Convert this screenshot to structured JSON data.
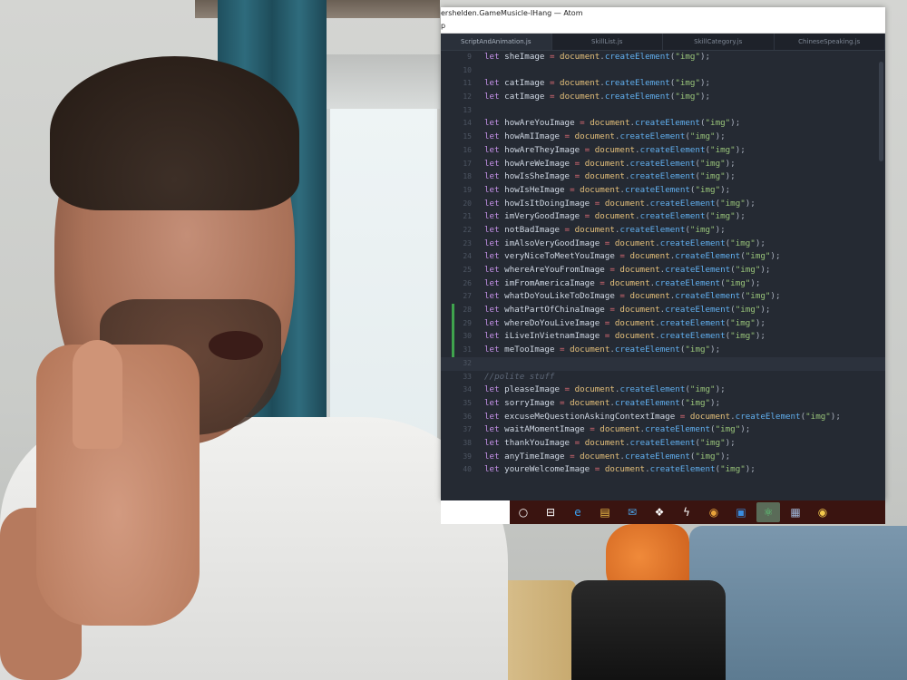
{
  "window": {
    "title": "ershelden.GameMusicle-IHang — Atom",
    "menu_label": "p"
  },
  "tabs": [
    {
      "label": "ScriptAndAnimation.js"
    },
    {
      "label": "SkillList.js"
    },
    {
      "label": "SkillCategory.js"
    },
    {
      "label": "ChineseSpeaking.js"
    }
  ],
  "code_lines": [
    {
      "num": "9",
      "marker": "",
      "kw": "let",
      "name": "sheImage",
      "obj": "document",
      "fn": "createElement",
      "arg": "\"img\""
    },
    {
      "num": "10",
      "marker": "",
      "blank": true
    },
    {
      "num": "11",
      "marker": "",
      "kw": "let",
      "name": "catImage",
      "obj": "document",
      "fn": "createElement",
      "arg": "\"img\""
    },
    {
      "num": "12",
      "marker": "",
      "kw": "let",
      "name": "catImage",
      "obj": "document",
      "fn": "createElement",
      "arg": "\"img\""
    },
    {
      "num": "13",
      "marker": "",
      "blank": true
    },
    {
      "num": "14",
      "marker": "",
      "kw": "let",
      "name": "howAreYouImage",
      "obj": "document",
      "fn": "createElement",
      "arg": "\"img\""
    },
    {
      "num": "15",
      "marker": "",
      "kw": "let",
      "name": "howAmIImage",
      "obj": "document",
      "fn": "createElement",
      "arg": "\"img\""
    },
    {
      "num": "16",
      "marker": "",
      "kw": "let",
      "name": "howAreTheyImage",
      "obj": "document",
      "fn": "createElement",
      "arg": "\"img\""
    },
    {
      "num": "17",
      "marker": "",
      "kw": "let",
      "name": "howAreWeImage",
      "obj": "document",
      "fn": "createElement",
      "arg": "\"img\""
    },
    {
      "num": "18",
      "marker": "",
      "kw": "let",
      "name": "howIsSheImage",
      "obj": "document",
      "fn": "createElement",
      "arg": "\"img\""
    },
    {
      "num": "19",
      "marker": "",
      "kw": "let",
      "name": "howIsHeImage",
      "obj": "document",
      "fn": "createElement",
      "arg": "\"img\""
    },
    {
      "num": "20",
      "marker": "",
      "kw": "let",
      "name": "howIsItDoingImage",
      "obj": "document",
      "fn": "createElement",
      "arg": "\"img\""
    },
    {
      "num": "21",
      "marker": "",
      "kw": "let",
      "name": "imVeryGoodImage",
      "obj": "document",
      "fn": "createElement",
      "arg": "\"img\""
    },
    {
      "num": "22",
      "marker": "",
      "kw": "let",
      "name": "notBadImage",
      "obj": "document",
      "fn": "createElement",
      "arg": "\"img\""
    },
    {
      "num": "23",
      "marker": "",
      "kw": "let",
      "name": "imAlsoVeryGoodImage",
      "obj": "document",
      "fn": "createElement",
      "arg": "\"img\""
    },
    {
      "num": "24",
      "marker": "",
      "kw": "let",
      "name": "veryNiceToMeetYouImage",
      "obj": "document",
      "fn": "createElement",
      "arg": "\"img\""
    },
    {
      "num": "25",
      "marker": "",
      "kw": "let",
      "name": "whereAreYouFromImage",
      "obj": "document",
      "fn": "createElement",
      "arg": "\"img\""
    },
    {
      "num": "26",
      "marker": "",
      "kw": "let",
      "name": "imFromAmericaImage",
      "obj": "document",
      "fn": "createElement",
      "arg": "\"img\""
    },
    {
      "num": "27",
      "marker": "",
      "kw": "let",
      "name": "whatDoYouLikeToDoImage",
      "obj": "document",
      "fn": "createElement",
      "arg": "\"img\""
    },
    {
      "num": "28",
      "marker": "#3fa34d",
      "kw": "let",
      "name": "whatPartOfChinaImage",
      "obj": "document",
      "fn": "createElement",
      "arg": "\"img\""
    },
    {
      "num": "29",
      "marker": "#3fa34d",
      "kw": "let",
      "name": "whereDoYouLiveImage",
      "obj": "document",
      "fn": "createElement",
      "arg": "\"img\""
    },
    {
      "num": "30",
      "marker": "#3fa34d",
      "kw": "let",
      "name": "iLiveInVietnamImage",
      "obj": "document",
      "fn": "createElement",
      "arg": "\"img\""
    },
    {
      "num": "31",
      "marker": "#3fa34d",
      "kw": "let",
      "name": "meTooImage",
      "obj": "document",
      "fn": "createElement",
      "arg": "\"img\""
    },
    {
      "num": "32",
      "marker": "",
      "blank": true,
      "highlight": true
    },
    {
      "num": "33",
      "marker": "",
      "comment": "//polite stuff"
    },
    {
      "num": "34",
      "marker": "",
      "kw": "let",
      "name": "pleaseImage",
      "obj": "document",
      "fn": "createElement",
      "arg": "\"img\""
    },
    {
      "num": "35",
      "marker": "",
      "kw": "let",
      "name": "sorryImage",
      "obj": "document",
      "fn": "createElement",
      "arg": "\"img\""
    },
    {
      "num": "36",
      "marker": "",
      "kw": "let",
      "name": "excuseMeQuestionAskingContextImage",
      "obj": "document",
      "fn": "createElement",
      "arg": "\"img\""
    },
    {
      "num": "37",
      "marker": "",
      "kw": "let",
      "name": "waitAMomentImage",
      "obj": "document",
      "fn": "createElement",
      "arg": "\"img\""
    },
    {
      "num": "38",
      "marker": "",
      "kw": "let",
      "name": "thankYouImage",
      "obj": "document",
      "fn": "createElement",
      "arg": "\"img\""
    },
    {
      "num": "39",
      "marker": "",
      "kw": "let",
      "name": "anyTimeImage",
      "obj": "document",
      "fn": "createElement",
      "arg": "\"img\""
    },
    {
      "num": "40",
      "marker": "",
      "kw": "let",
      "name": "youreWelcomeImage",
      "obj": "document",
      "fn": "createElement",
      "arg": "\"img\""
    }
  ],
  "taskbar": {
    "items": [
      {
        "name": "cortana-icon",
        "glyph": "○",
        "color": "#ffffff",
        "active": false
      },
      {
        "name": "task-view-icon",
        "glyph": "⊟",
        "color": "#ffffff",
        "active": false
      },
      {
        "name": "edge-icon",
        "glyph": "e",
        "color": "#3aa0f0",
        "active": false
      },
      {
        "name": "file-explorer-icon",
        "glyph": "▤",
        "color": "#f3c24a",
        "active": false
      },
      {
        "name": "mail-icon",
        "glyph": "✉",
        "color": "#4aa3e8",
        "active": false
      },
      {
        "name": "dropbox-icon",
        "glyph": "❖",
        "color": "#ffffff",
        "active": false
      },
      {
        "name": "terminal-icon",
        "glyph": "ϟ",
        "color": "#ffffff",
        "active": false
      },
      {
        "name": "chrome-icon",
        "glyph": "◉",
        "color": "#e8a33a",
        "active": false
      },
      {
        "name": "store-icon",
        "glyph": "▣",
        "color": "#3a8de0",
        "active": false
      },
      {
        "name": "atom-icon",
        "glyph": "⚛",
        "color": "#5fd07a",
        "active": true
      },
      {
        "name": "document-icon",
        "glyph": "▦",
        "color": "#9fb6d8",
        "active": false
      },
      {
        "name": "chrome-canary-icon",
        "glyph": "◉",
        "color": "#f2c94c",
        "active": false
      }
    ]
  }
}
